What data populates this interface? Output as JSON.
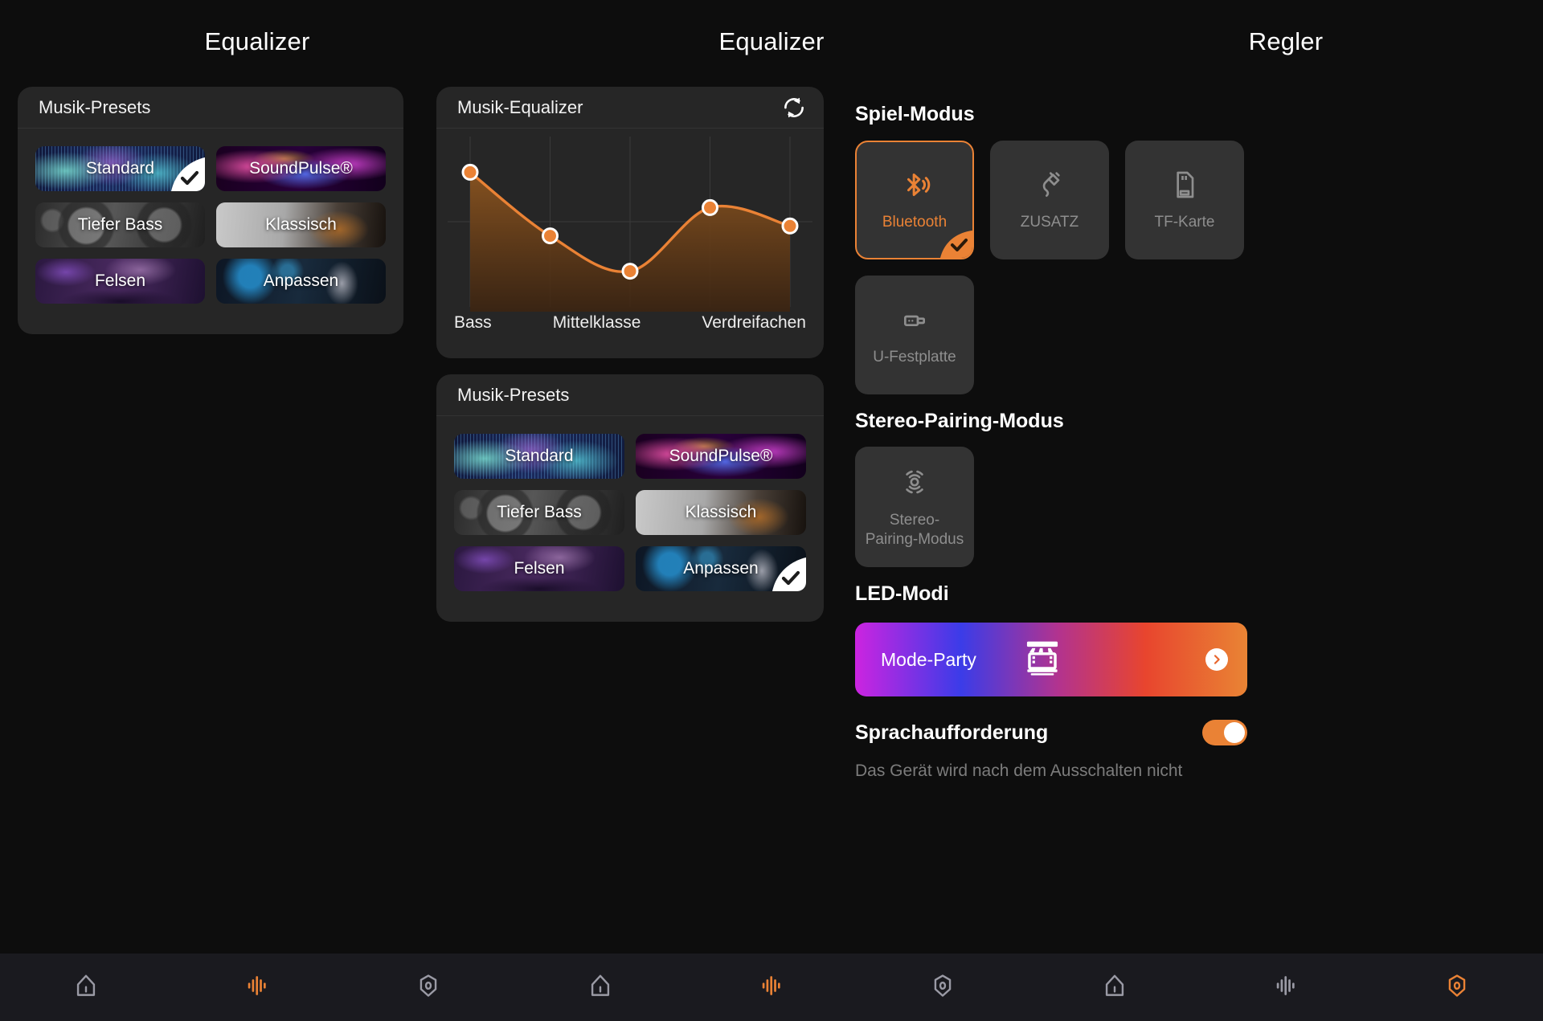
{
  "panels": {
    "left_title": "Equalizer",
    "mid_title": "Equalizer",
    "right_title": "Regler"
  },
  "left_card": {
    "header": "Musik-Presets",
    "presets": [
      {
        "label": "Standard",
        "thumb": "th-standard",
        "selected": true
      },
      {
        "label": "SoundPulse®",
        "thumb": "th-soundpulse",
        "selected": false
      },
      {
        "label": "Tiefer Bass",
        "thumb": "th-bass",
        "selected": false
      },
      {
        "label": "Klassisch",
        "thumb": "th-klassisch",
        "selected": false
      },
      {
        "label": "Felsen",
        "thumb": "th-felsen",
        "selected": false
      },
      {
        "label": "Anpassen",
        "thumb": "th-anpassen",
        "selected": false
      }
    ]
  },
  "mid_card": {
    "header": "Musik-Equalizer",
    "refresh_icon": "refresh-icon",
    "presets_header": "Musik-Presets",
    "presets": [
      {
        "label": "Standard",
        "thumb": "th-standard",
        "selected": false
      },
      {
        "label": "SoundPulse®",
        "thumb": "th-soundpulse",
        "selected": false
      },
      {
        "label": "Tiefer Bass",
        "thumb": "th-bass",
        "selected": false
      },
      {
        "label": "Klassisch",
        "thumb": "th-klassisch",
        "selected": false
      },
      {
        "label": "Felsen",
        "thumb": "th-felsen",
        "selected": false
      },
      {
        "label": "Anpassen",
        "thumb": "th-anpassen",
        "selected": true
      }
    ]
  },
  "chart_data": {
    "type": "line",
    "title": "Musik-Equalizer",
    "categories": [
      "Bass",
      "",
      "Mittelklasse",
      "",
      "Verdreifachen"
    ],
    "tick_labels": [
      "Bass",
      "Mittelklasse",
      "Verdreifachen"
    ],
    "x": [
      0,
      1,
      2,
      3,
      4
    ],
    "values": [
      8.5,
      4.0,
      1.5,
      6.0,
      4.7
    ],
    "ylim": [
      0,
      10
    ],
    "xlabel": "",
    "ylabel": "",
    "grid": true,
    "fill": true,
    "line_color": "#ea8235",
    "fill_color": "#8a5420",
    "marker_color": "#ea8235",
    "marker_edge_color": "#ffffff",
    "legend": "none"
  },
  "right_panel": {
    "play_mode": {
      "heading": "Spiel-Modus",
      "tiles": [
        {
          "label": "Bluetooth",
          "icon": "bluetooth-icon",
          "selected": true
        },
        {
          "label": "ZUSATZ",
          "icon": "aux-plug-icon",
          "selected": false
        },
        {
          "label": "TF-Karte",
          "icon": "sd-card-icon",
          "selected": false
        },
        {
          "label": "U-Festplatte",
          "icon": "usb-drive-icon",
          "selected": false
        }
      ]
    },
    "stereo": {
      "heading": "Stereo-Pairing-Modus",
      "tile": {
        "label": "Stereo-\nPairing-Modus",
        "icon": "stereo-pairing-icon",
        "selected": false
      }
    },
    "led": {
      "heading": "LED-Modi",
      "mode_label": "Mode-Party",
      "icon": "stage-lights-icon",
      "arrow_icon": "chevron-right-icon"
    },
    "voice": {
      "label": "Sprachaufforderung",
      "toggle_on": true,
      "description": "Das Gerät wird nach dem Ausschalten nicht"
    }
  },
  "navbar": {
    "panels": [
      [
        {
          "icon": "home-icon",
          "active": false
        },
        {
          "icon": "equalizer-icon",
          "active": true
        },
        {
          "icon": "settings-icon",
          "active": false
        }
      ],
      [
        {
          "icon": "home-icon",
          "active": false
        },
        {
          "icon": "equalizer-icon",
          "active": true
        },
        {
          "icon": "settings-icon",
          "active": false
        }
      ],
      [
        {
          "icon": "home-icon",
          "active": false
        },
        {
          "icon": "equalizer-icon",
          "active": false
        },
        {
          "icon": "settings-icon",
          "active": true
        }
      ]
    ]
  },
  "colors": {
    "accent": "#ea8235",
    "background": "#0d0d0d",
    "card": "#262626",
    "tile": "#333333",
    "nav": "#1a1a1f",
    "muted_text": "#8e8e8e"
  }
}
